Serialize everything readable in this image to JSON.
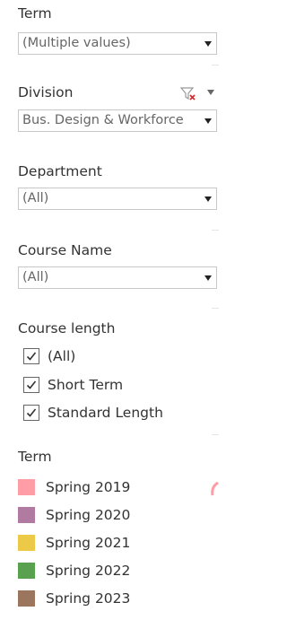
{
  "filters": {
    "term": {
      "title": "Term",
      "value": "(Multiple values)"
    },
    "division": {
      "title": "Division",
      "value": "Bus. Design & Workforce"
    },
    "department": {
      "title": "Department",
      "value": "(All)"
    },
    "course_name": {
      "title": "Course Name",
      "value": "(All)"
    },
    "course_length": {
      "title": "Course length",
      "options": [
        {
          "label": "(All)",
          "checked": true
        },
        {
          "label": "Short Term",
          "checked": true
        },
        {
          "label": "Standard Length",
          "checked": true
        }
      ]
    }
  },
  "legend": {
    "title": "Term",
    "items": [
      {
        "label": "Spring 2019",
        "color": "#ff9da7"
      },
      {
        "label": "Spring 2020",
        "color": "#b07aa1"
      },
      {
        "label": "Spring 2021",
        "color": "#edc948"
      },
      {
        "label": "Spring 2022",
        "color": "#59a14f"
      },
      {
        "label": "Spring 2023",
        "color": "#9c755f"
      }
    ]
  },
  "colors": {
    "clear_filter_icon": "#d62728",
    "edge_arc": "#ff9da7"
  }
}
